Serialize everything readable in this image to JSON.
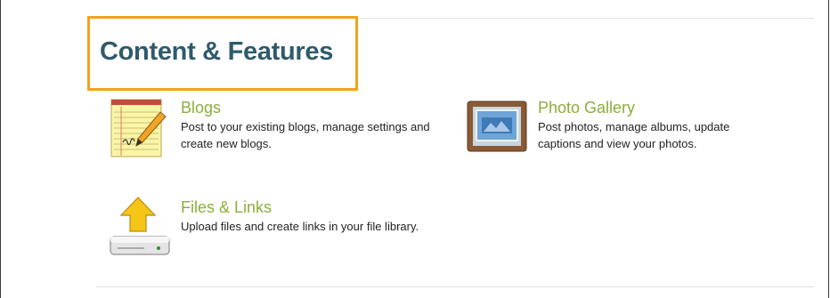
{
  "section": {
    "title": "Content & Features"
  },
  "features": [
    {
      "icon": "notepad-pencil-icon",
      "title": "Blogs",
      "description": "Post to your existing blogs, manage settings and create new blogs."
    },
    {
      "icon": "photo-album-icon",
      "title": "Photo Gallery",
      "description": "Post photos, manage albums, update captions and view your photos."
    },
    {
      "icon": "upload-drive-icon",
      "title": "Files & Links",
      "description": "Upload files and create links in your file library."
    }
  ],
  "colors": {
    "title_accent": "#8dad3a",
    "heading": "#2f5b6b",
    "highlight_border": "#f2a31b"
  }
}
